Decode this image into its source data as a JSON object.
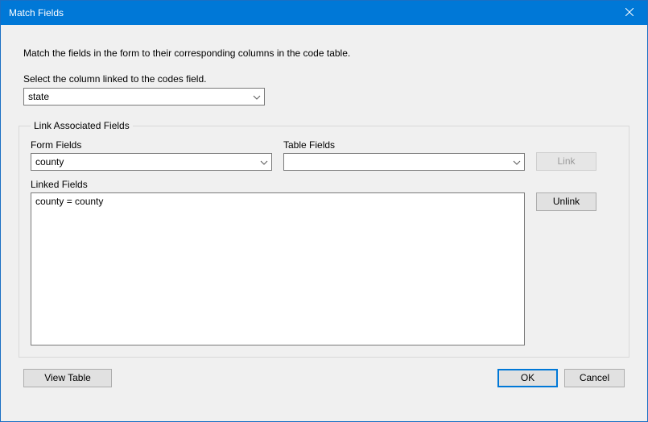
{
  "title": "Match Fields",
  "intro": "Match the fields in the form to their corresponding columns in the code table.",
  "codes": {
    "label": "Select the column linked to the codes field.",
    "value": "state"
  },
  "group": {
    "legend": "Link Associated Fields",
    "form_fields": {
      "label": "Form Fields",
      "value": "county"
    },
    "table_fields": {
      "label": "Table Fields",
      "value": ""
    },
    "link_btn": "Link",
    "linked_label": "Linked Fields",
    "linked_entries": [
      "county = county"
    ],
    "unlink_btn": "Unlink"
  },
  "footer": {
    "view_table": "View Table",
    "ok": "OK",
    "cancel": "Cancel"
  }
}
